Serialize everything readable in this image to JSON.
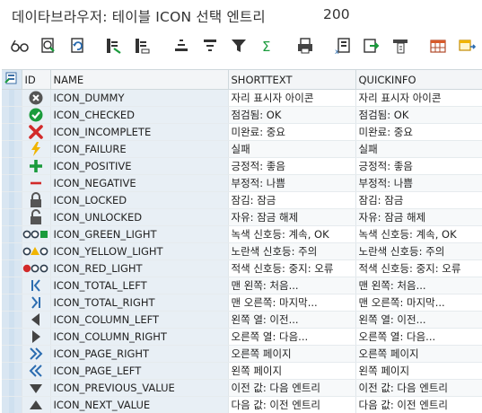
{
  "window": {
    "title": "데이타브라우저: 테이블 ICON 선택 엔트리",
    "count": "200"
  },
  "toolbar": {
    "buttons": [
      {
        "name": "display-glasses-button",
        "icon": "glasses-icon"
      },
      {
        "name": "check-entry-button",
        "icon": "document-check-icon"
      },
      {
        "name": "refresh-button",
        "icon": "refresh-icon"
      },
      {
        "name": "select-column-button",
        "icon": "select-column-icon"
      },
      {
        "name": "deselect-column-button",
        "icon": "deselect-column-icon"
      },
      {
        "name": "sort-ascending-button",
        "icon": "sort-ascending-icon"
      },
      {
        "name": "sort-descending-button",
        "icon": "sort-descending-icon"
      },
      {
        "name": "filter-button",
        "icon": "filter-icon"
      },
      {
        "name": "total-button",
        "icon": "sigma-icon"
      },
      {
        "name": "print-button",
        "icon": "print-icon"
      },
      {
        "name": "export-excel-button",
        "icon": "excel-export-icon"
      },
      {
        "name": "export-file-button",
        "icon": "export-file-icon"
      },
      {
        "name": "layout-button",
        "icon": "layout-icon"
      },
      {
        "name": "grid-layout-button",
        "icon": "grid-layout-icon"
      },
      {
        "name": "choose-layout-button",
        "icon": "choose-layout-icon"
      }
    ]
  },
  "grid": {
    "columns": [
      "ID",
      "NAME",
      "SHORTTEXT",
      "QUICKINFO"
    ],
    "rows": [
      {
        "icon": "dummy-icon",
        "name": "ICON_DUMMY",
        "shorttext": "자리 표시자 아이콘",
        "quickinfo": "자리 표시자 아이콘"
      },
      {
        "icon": "checked-icon",
        "name": "ICON_CHECKED",
        "shorttext": "점검됨: OK",
        "quickinfo": "점검됨: OK"
      },
      {
        "icon": "incomplete-icon",
        "name": "ICON_INCOMPLETE",
        "shorttext": "미완료: 중요",
        "quickinfo": "미완료: 중요"
      },
      {
        "icon": "failure-icon",
        "name": "ICON_FAILURE",
        "shorttext": "실패",
        "quickinfo": "실패"
      },
      {
        "icon": "positive-icon",
        "name": "ICON_POSITIVE",
        "shorttext": "긍정적: 좋음",
        "quickinfo": "긍정적: 좋음"
      },
      {
        "icon": "negative-icon",
        "name": "ICON_NEGATIVE",
        "shorttext": "부정적: 나쁨",
        "quickinfo": "부정적: 나쁨"
      },
      {
        "icon": "locked-icon",
        "name": "ICON_LOCKED",
        "shorttext": "잠김: 잠금",
        "quickinfo": "잠김: 잠금"
      },
      {
        "icon": "unlocked-icon",
        "name": "ICON_UNLOCKED",
        "shorttext": "자유: 잠금 해제",
        "quickinfo": "자유: 잠금 해제"
      },
      {
        "icon": "green-light-icon",
        "name": "ICON_GREEN_LIGHT",
        "shorttext": "녹색 신호등: 계속, OK",
        "quickinfo": "녹색 신호등: 계속, OK"
      },
      {
        "icon": "yellow-light-icon",
        "name": "ICON_YELLOW_LIGHT",
        "shorttext": "노란색 신호등: 주의",
        "quickinfo": "노란색 신호등: 주의"
      },
      {
        "icon": "red-light-icon",
        "name": "ICON_RED_LIGHT",
        "shorttext": "적색 신호등: 중지: 오류",
        "quickinfo": "적색 신호등: 중지: 오류"
      },
      {
        "icon": "total-left-icon",
        "name": "ICON_TOTAL_LEFT",
        "shorttext": "맨 왼쪽: 처음...",
        "quickinfo": "맨 왼쪽: 처음..."
      },
      {
        "icon": "total-right-icon",
        "name": "ICON_TOTAL_RIGHT",
        "shorttext": "맨 오른쪽: 마지막...",
        "quickinfo": "맨 오른쪽: 마지막..."
      },
      {
        "icon": "column-left-icon",
        "name": "ICON_COLUMN_LEFT",
        "shorttext": "왼쪽 열: 이전...",
        "quickinfo": "왼쪽 열: 이전..."
      },
      {
        "icon": "column-right-icon",
        "name": "ICON_COLUMN_RIGHT",
        "shorttext": "오른쪽 열: 다음...",
        "quickinfo": "오른쪽 열: 다음..."
      },
      {
        "icon": "page-right-icon",
        "name": "ICON_PAGE_RIGHT",
        "shorttext": "오른쪽 페이지",
        "quickinfo": "오른쪽 페이지"
      },
      {
        "icon": "page-left-icon",
        "name": "ICON_PAGE_LEFT",
        "shorttext": "왼쪽 페이지",
        "quickinfo": "왼쪽 페이지"
      },
      {
        "icon": "previous-value-icon",
        "name": "ICON_PREVIOUS_VALUE",
        "shorttext": "이전 값: 다음 엔트리",
        "quickinfo": "이전 값: 다음 엔트리"
      },
      {
        "icon": "next-value-icon",
        "name": "ICON_NEXT_VALUE",
        "shorttext": "다음 값: 이전 엔트리",
        "quickinfo": "다음 값: 이전 엔트리"
      }
    ]
  },
  "colors": {
    "accent_blue": "#2b6cb0",
    "green": "#1a9b3c",
    "red": "#d22a2a",
    "yellow": "#f0b400"
  }
}
